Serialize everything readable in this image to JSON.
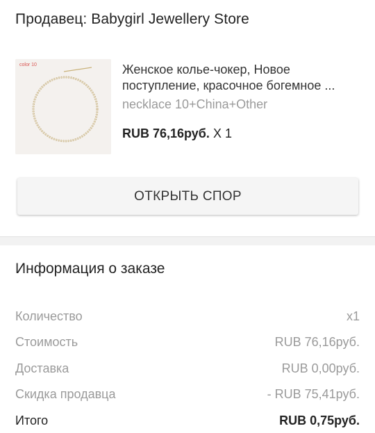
{
  "seller": {
    "label": "Продавец: Babygirl Jewellery Store"
  },
  "product": {
    "image_tag": "color 10",
    "title_line1": "Женское колье-чокер, Новое",
    "title_line2": "поступление, красочное богемное ...",
    "variant": "necklace 10+China+Other",
    "price": "RUB 76,16руб.",
    "quantity": "X 1"
  },
  "dispute_button": {
    "label": "ОТКРЫТЬ СПОР"
  },
  "order_info": {
    "title": "Информация о заказе",
    "rows": [
      {
        "label": "Количество",
        "value": "x1"
      },
      {
        "label": "Стоимость",
        "value": "RUB 76,16руб."
      },
      {
        "label": "Доставка",
        "value": "RUB 0,00руб."
      },
      {
        "label": "Скидка продавца",
        "value": "- RUB 75,41руб."
      },
      {
        "label": "Итого",
        "value": "RUB 0,75руб."
      }
    ]
  },
  "colors": {
    "text": "#222222",
    "muted": "#9a9a9a",
    "button_bg": "#f5f5f5"
  }
}
